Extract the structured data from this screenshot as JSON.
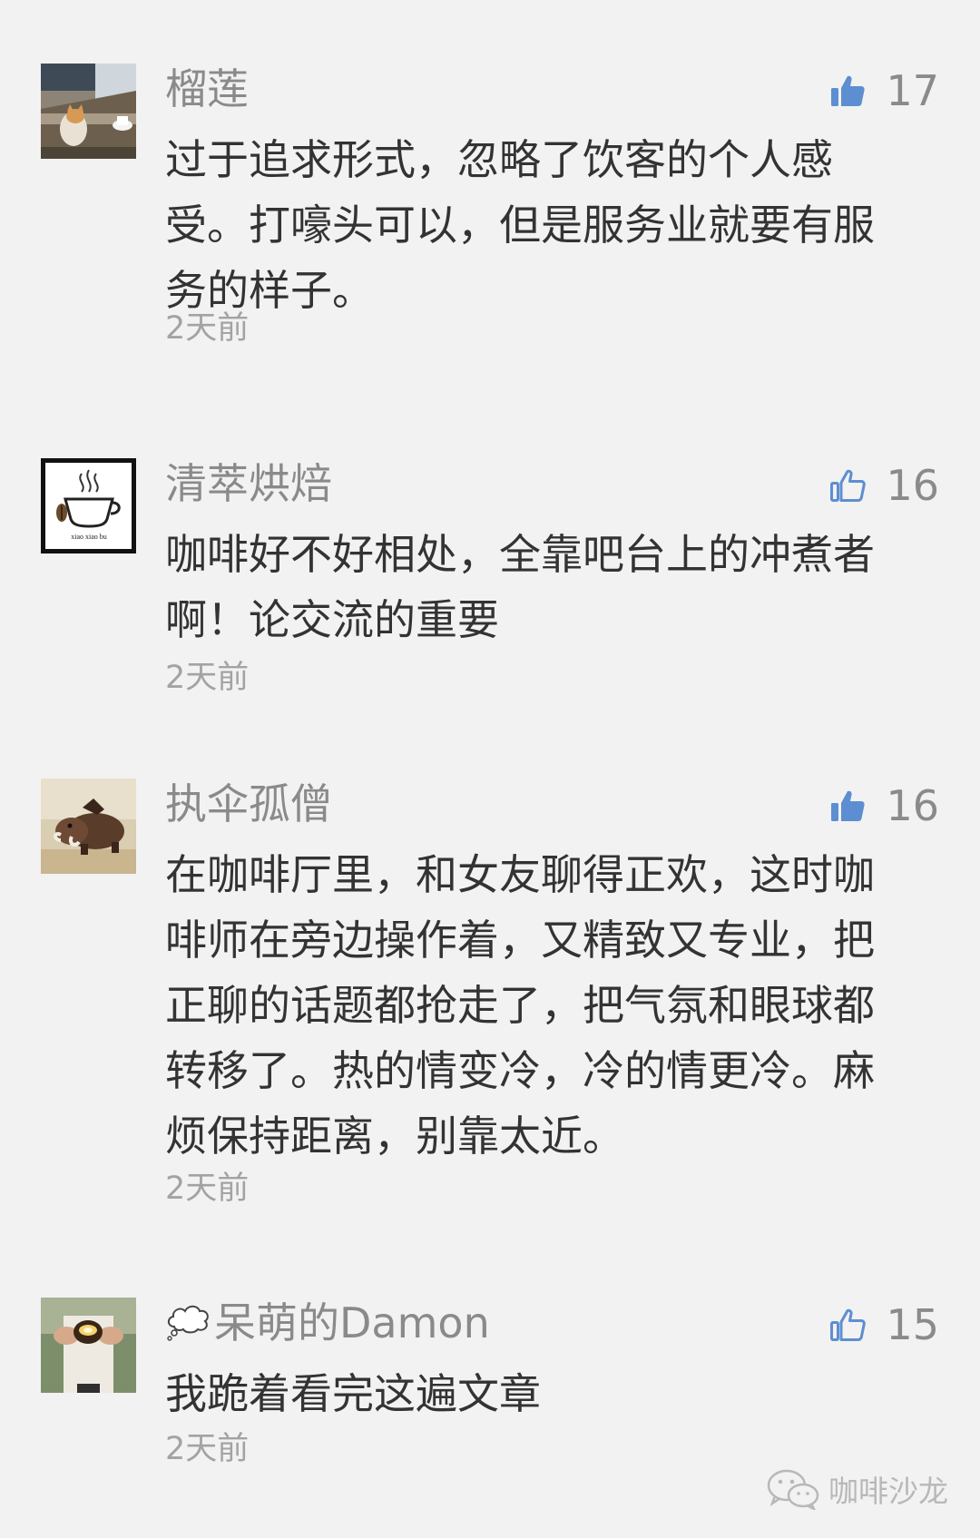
{
  "comments": [
    {
      "nickname": "榴莲",
      "likes": "17",
      "liked": true,
      "text": "过于追求形式，忽略了饮客的个人感受。打嚎头可以，但是服务业就要有服务的样子。",
      "time": "2天前",
      "avatar": "cat-cafe-photo"
    },
    {
      "nickname": "清萃烘焙",
      "likes": "16",
      "liked": false,
      "text": "咖啡好不好相处，全靠吧台上的冲煮者啊！论交流的重要",
      "time": "2天前",
      "avatar": "coffee-logo",
      "avatar_caption": "xiao xiao bu"
    },
    {
      "nickname": "执伞孤僧",
      "likes": "16",
      "liked": true,
      "text": "在咖啡厅里，和女友聊得正欢，这时咖啡师在旁边操作着，又精致又专业，把正聊的话题都抢走了，把气氛和眼球都转移了。热的情变冷，冷的情更冷。麻烦保持距离，别靠太近。",
      "time": "2天前",
      "avatar": "warthog-toy-photo"
    },
    {
      "nickname": "呆萌的Damon",
      "likes": "15",
      "liked": false,
      "text": "我跪着看完这遍文章",
      "time": "2天前",
      "avatar": "hands-cup-photo",
      "nickname_icon": "thought-bubble-icon"
    }
  ],
  "watermark": {
    "text": "咖啡沙龙",
    "icon": "wechat-icon"
  },
  "colors": {
    "background": "#f2f2f2",
    "nickname": "#8a8a8a",
    "body_text": "#333333",
    "like_icon": "#5d8ed1",
    "time": "#a3a3a3"
  }
}
